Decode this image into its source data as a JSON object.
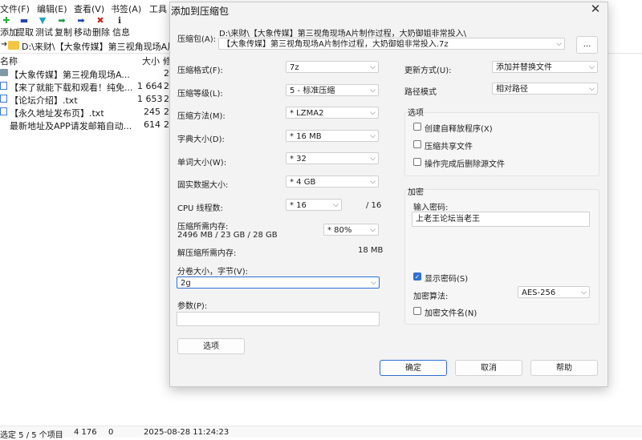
{
  "menu": [
    "文件(F)",
    "编辑(E)",
    "查看(V)",
    "书签(A)",
    "工具"
  ],
  "toolbar": [
    {
      "label": "添加",
      "icon": "add-icon"
    },
    {
      "label": "提取",
      "icon": "extract-icon"
    },
    {
      "label": "测试",
      "icon": "test-icon"
    },
    {
      "label": "复制",
      "icon": "copy-icon"
    },
    {
      "label": "移动",
      "icon": "move-icon"
    },
    {
      "label": "删除",
      "icon": "delete-icon"
    },
    {
      "label": "信息",
      "icon": "info-icon"
    }
  ],
  "path": "D:\\来财\\【大象传媒】第三视角现场A片",
  "columns": {
    "name": "名称",
    "size": "大小",
    "extra": "修"
  },
  "files": [
    {
      "name": "【大象传媒】第三视角现场A...",
      "size": "",
      "extra": "2"
    },
    {
      "name": "【来了就能下载和观看！纯免...",
      "size": "1 664",
      "extra": "2"
    },
    {
      "name": "【论坛介绍】.txt",
      "size": "1 653",
      "extra": "2"
    },
    {
      "name": "【永久地址发布页】.txt",
      "size": "245",
      "extra": "2"
    },
    {
      "name": "最新地址及APP请发邮箱自动...",
      "size": "614",
      "extra": "2"
    }
  ],
  "status": {
    "selection": "选定 5 / 5 个项目",
    "size": "4 176",
    "zero": "0",
    "datetime": "2025-08-28 11:24:23"
  },
  "dialog": {
    "title": "添加到压缩包",
    "archive_label": "压缩包(A):",
    "archive_dir": "D:\\来财\\【大象传媒】第三视角现场A片制作过程，大奶御姐非常投入\\",
    "archive_name": "【大象传媒】第三视角现场A片制作过程，大奶御姐非常投入.7z",
    "browse": "...",
    "format_label": "压缩格式(F):",
    "format": "7z",
    "level_label": "压缩等级(L):",
    "level": "5 - 标准压缩",
    "method_label": "压缩方法(M):",
    "method": "* LZMA2",
    "dict_label": "字典大小(D):",
    "dict": "* 16 MB",
    "word_label": "单词大小(W):",
    "word": "* 32",
    "solid_label": "固实数据大小:",
    "solid": "* 4 GB",
    "threads_label": "CPU 线程数:",
    "threads": "* 16",
    "threads_max": "/ 16",
    "mem_label": "压缩所需内存:",
    "mem_value": "2496 MB / 23 GB / 28 GB",
    "mem_pct": "* 80%",
    "decomp_label": "解压缩所需内存:",
    "decomp_value": "18 MB",
    "volume_label": "分卷大小，字节(V):",
    "volume": "2g",
    "params_label": "参数(P):",
    "params": "",
    "options_btn": "选项",
    "update_label": "更新方式(U):",
    "update": "添加并替换文件",
    "pathmode_label": "路径模式",
    "pathmode": "相对路径",
    "options_group": "选项",
    "opt_sfx": "创建自释放程序(X)",
    "opt_shared": "压缩共享文件",
    "opt_delete": "操作完成后删除源文件",
    "encrypt_group": "加密",
    "password_label": "输入密码:",
    "password": "上老王论坛当老王",
    "show_password": "显示密码(S)",
    "enc_method_label": "加密算法:",
    "enc_method": "AES-256",
    "enc_names": "加密文件名(N)",
    "ok": "确定",
    "cancel": "取消",
    "help": "帮助"
  }
}
